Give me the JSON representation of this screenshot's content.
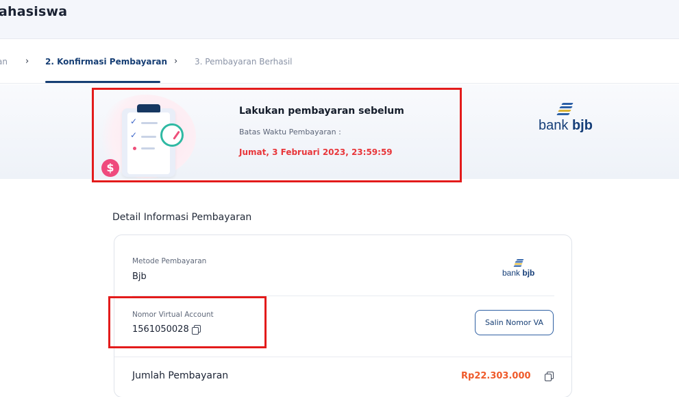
{
  "header": {
    "title": "ahasiswa"
  },
  "stepper": {
    "step1": "an",
    "step2": "2. Konfirmasi Pembayaran",
    "step3": "3. Pembayaran Berhasil"
  },
  "deadline": {
    "heading": "Lakukan pembayaran sebelum",
    "label": "Batas Waktu Pembayaran :",
    "value": "Jumat, 3 Februari 2023, 23:59:59"
  },
  "bank": {
    "name_light": "bank ",
    "name_bold": "bjb"
  },
  "payment_details": {
    "title": "Detail Informasi Pembayaran",
    "method_label": "Metode Pembayaran",
    "method_value": "Bjb",
    "va_label": "Nomor Virtual Account",
    "va_value": "1561050028",
    "copy_button": "Salin Nomor VA",
    "amount_label": "Jumlah Pembayaran",
    "amount_value": "Rp22.303.000"
  },
  "colors": {
    "accent_navy": "#163e74",
    "deadline_red": "#e8363a",
    "amount_orange": "#ef5a2a",
    "highlight_red": "#e31b1b"
  },
  "icons": [
    "chevron-right-icon",
    "copy-icon",
    "clipboard-clock-illustration",
    "bank-bjb-logo"
  ]
}
